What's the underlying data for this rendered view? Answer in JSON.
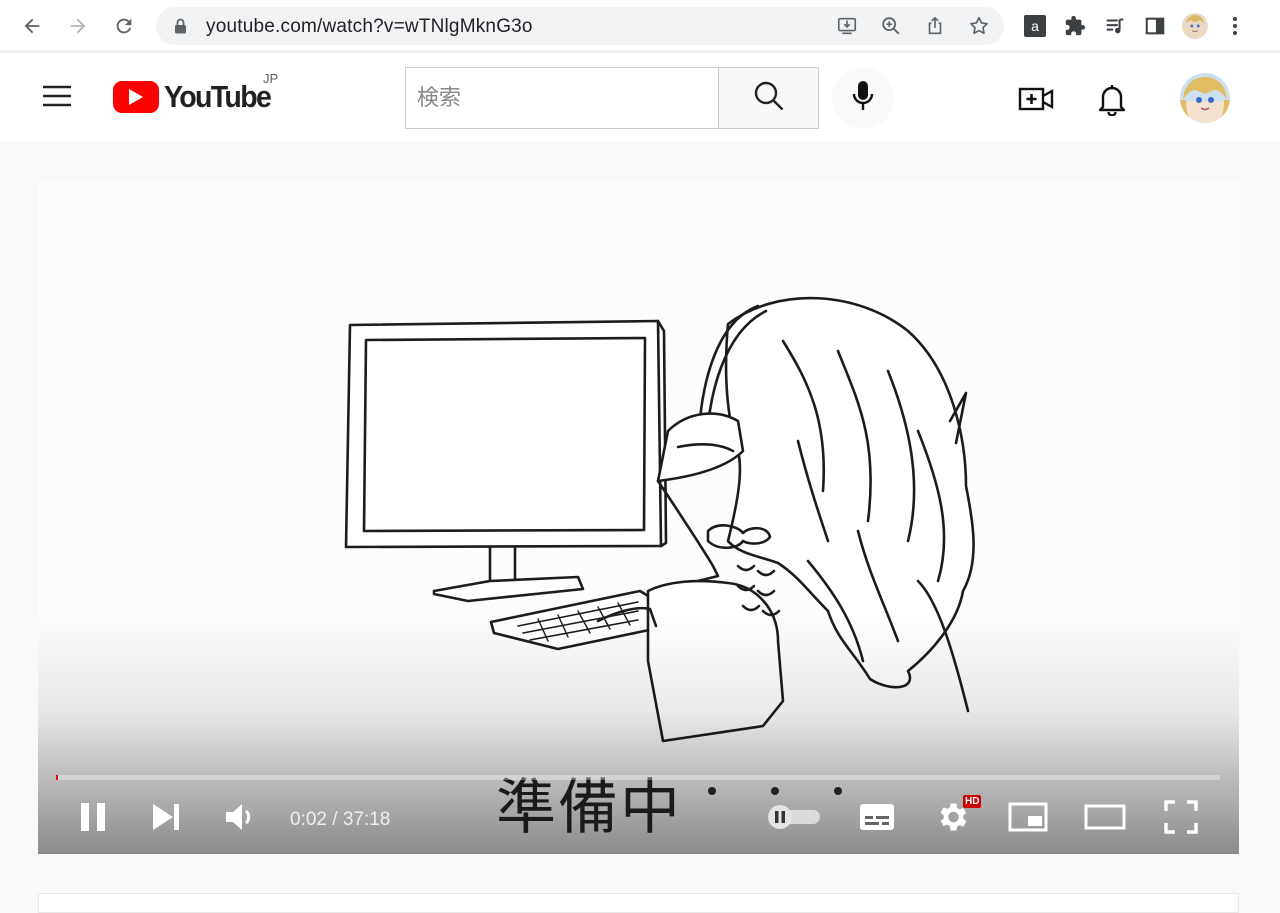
{
  "browser": {
    "url": "youtube.com/watch?v=wTNlgMknG3o",
    "icons": [
      "back-icon",
      "forward-icon",
      "reload-icon",
      "lock-icon",
      "install-icon",
      "zoom-icon",
      "share-icon",
      "bookmark-star-icon",
      "extension-a-icon",
      "puzzle-icon",
      "media-queue-icon",
      "side-panel-icon",
      "profile-avatar",
      "kebab-menu-icon"
    ]
  },
  "header": {
    "logo_text": "YouTube",
    "region": "JP",
    "search_placeholder": "検索",
    "icons": [
      "menu-icon",
      "search-icon",
      "mic-icon",
      "create-video-icon",
      "bell-icon",
      "avatar"
    ]
  },
  "player": {
    "subtitle": "準備中",
    "time_current": "0:02",
    "time_separator": " / ",
    "time_total": "37:18",
    "progress": 0.001,
    "hd_badge": "HD",
    "colors": {
      "progress": "#ff0000",
      "brand": "#ff0000"
    }
  }
}
